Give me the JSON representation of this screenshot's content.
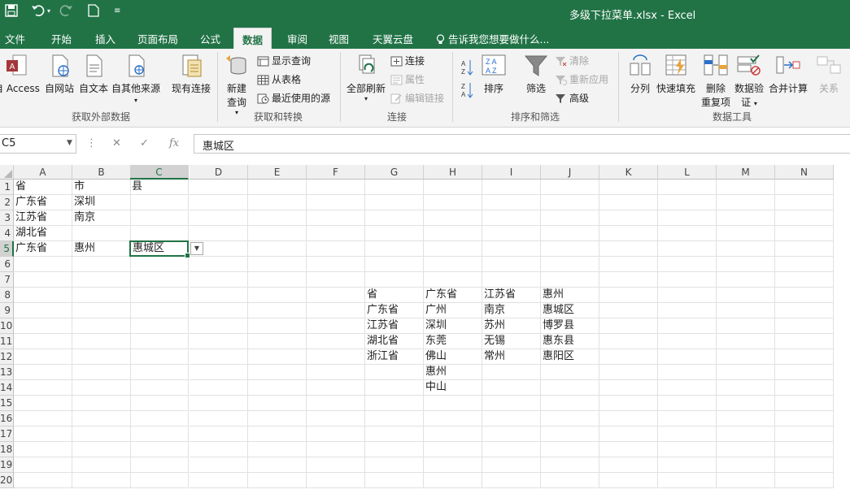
{
  "window": {
    "title": "多级下拉菜单.xlsx - Excel"
  },
  "tabs": [
    "文件",
    "开始",
    "插入",
    "页面布局",
    "公式",
    "数据",
    "审阅",
    "视图",
    "天翼云盘"
  ],
  "active_tab": "数据",
  "tell_me": "告诉我您想要做什么...",
  "ribbon": {
    "get_external": {
      "label": "获取外部数据",
      "buttons": [
        "自 Access",
        "自网站",
        "自文本",
        "自其他来源",
        "现有连接"
      ]
    },
    "get_transform": {
      "label": "获取和转换",
      "new_query": "新建",
      "new_query_2": "查询",
      "show_queries": "显示查询",
      "from_table": "从表格",
      "recent_sources": "最近使用的源"
    },
    "connections": {
      "label": "连接",
      "refresh_all": "全部刷新",
      "connections": "连接",
      "properties": "属性",
      "edit_links": "编辑链接"
    },
    "sort_filter": {
      "label": "排序和筛选",
      "sort": "排序",
      "filter": "筛选",
      "clear": "清除",
      "reapply": "重新应用",
      "advanced": "高级"
    },
    "data_tools": {
      "label": "数据工具",
      "text_to_columns": "分列",
      "flash_fill": "快速填充",
      "remove_dup_1": "删除",
      "remove_dup_2": "重复项",
      "validation_1": "数据验",
      "validation_2": "证",
      "consolidate": "合并计算",
      "relationships": "关系"
    }
  },
  "name_box": "C5",
  "formula_value": "惠城区",
  "fx_label": "fx",
  "columns": [
    "A",
    "B",
    "C",
    "D",
    "E",
    "F",
    "G",
    "H",
    "I",
    "J",
    "K",
    "L",
    "M",
    "N"
  ],
  "rows": [
    "1",
    "2",
    "3",
    "4",
    "5",
    "6",
    "7",
    "8",
    "9",
    "10",
    "11",
    "12",
    "13",
    "14",
    "15",
    "16",
    "17",
    "18",
    "19",
    "20"
  ],
  "cells": {
    "A1": "省",
    "B1": "市",
    "C1": "县",
    "A2": "广东省",
    "B2": "深圳",
    "A3": "江苏省",
    "B3": "南京",
    "A4": "湖北省",
    "A5": "广东省",
    "B5": "惠州",
    "C5": "惠城区",
    "G8": "省",
    "H8": "广东省",
    "I8": "江苏省",
    "J8": "惠州",
    "G9": "广东省",
    "H9": "广州",
    "I9": "南京",
    "J9": "惠城区",
    "G10": "江苏省",
    "H10": "深圳",
    "I10": "苏州",
    "J10": "博罗县",
    "G11": "湖北省",
    "H11": "东莞",
    "I11": "无锡",
    "J11": "惠东县",
    "G12": "浙江省",
    "H12": "佛山",
    "I12": "常州",
    "J12": "惠阳区",
    "H13": "惠州",
    "H14": "中山"
  },
  "active_cell": "C5",
  "colors": {
    "excel_green": "#217346"
  }
}
